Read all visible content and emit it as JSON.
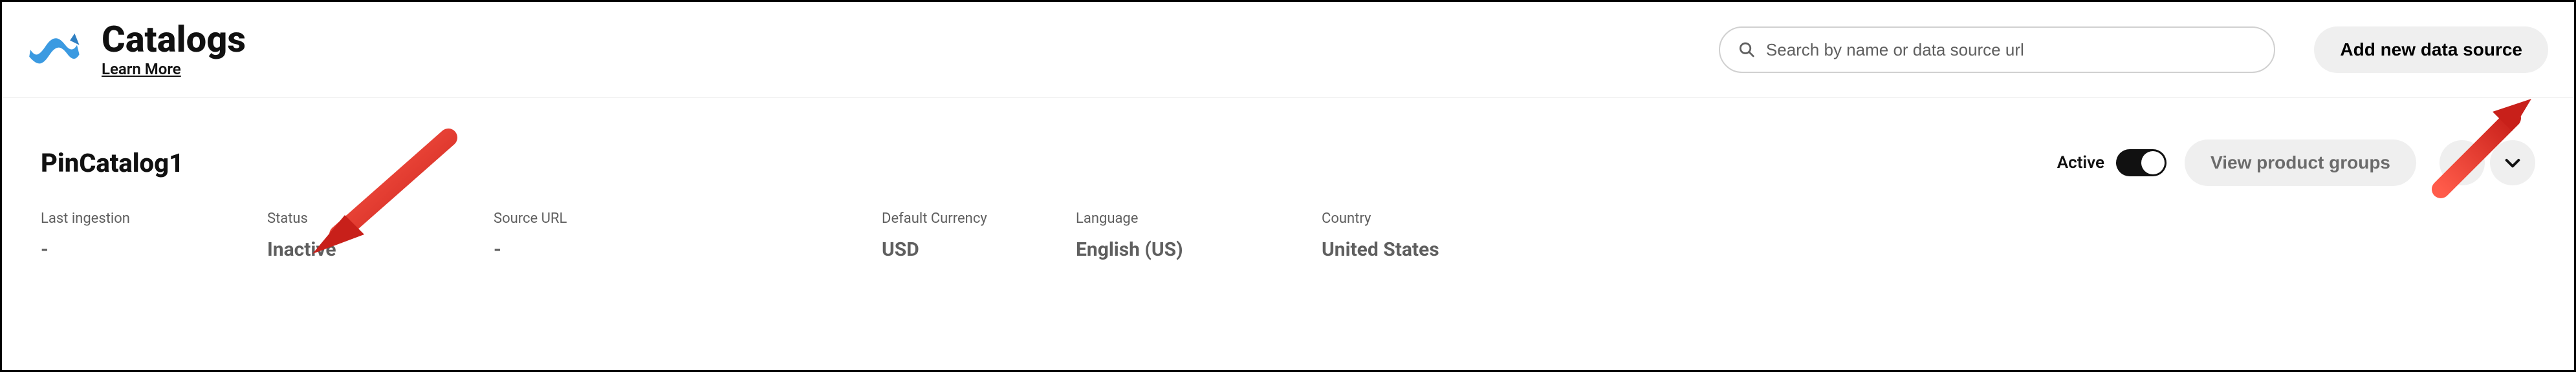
{
  "header": {
    "title": "Catalogs",
    "learn_more": "Learn More",
    "search_placeholder": "Search by name or data source url",
    "add_button": "Add new data source"
  },
  "catalog": {
    "name": "PinCatalog1",
    "active_label": "Active",
    "view_groups": "View product groups",
    "fields": {
      "last_ingestion_label": "Last ingestion",
      "last_ingestion_value": "-",
      "status_label": "Status",
      "status_value": "Inactive",
      "source_url_label": "Source URL",
      "source_url_value": "-",
      "currency_label": "Default Currency",
      "currency_value": "USD",
      "language_label": "Language",
      "language_value": "English (US)",
      "country_label": "Country",
      "country_value": "United States"
    }
  }
}
